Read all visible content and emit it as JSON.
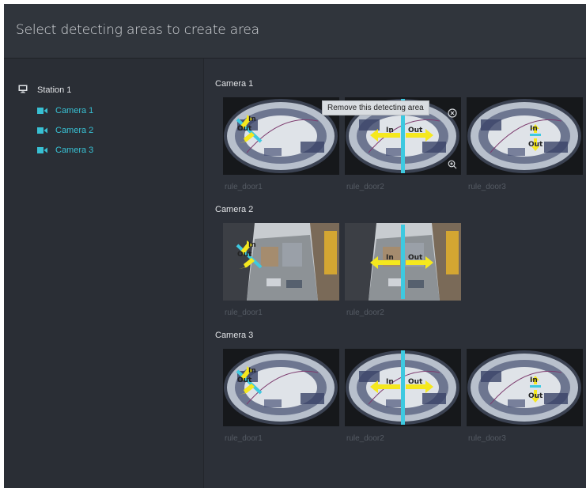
{
  "header": {
    "title": "Select detecting areas to create area"
  },
  "sidebar": {
    "station": {
      "label": "Station 1",
      "icon": "monitor-icon"
    },
    "cameras": [
      {
        "label": "Camera 1",
        "icon": "video-camera-icon"
      },
      {
        "label": "Camera 2",
        "icon": "video-camera-icon"
      },
      {
        "label": "Camera 3",
        "icon": "video-camera-icon"
      }
    ]
  },
  "overlay": {
    "in_label": "In",
    "out_label": "Out"
  },
  "sections": [
    {
      "title": "Camera 1",
      "rules": [
        {
          "label": "rule_door1",
          "view": "fisheye",
          "line": "diagonal"
        },
        {
          "label": "rule_door2",
          "view": "fisheye",
          "line": "vertical"
        },
        {
          "label": "rule_door3",
          "view": "fisheye",
          "line": "short"
        }
      ]
    },
    {
      "title": "Camera 2",
      "rules": [
        {
          "label": "rule_door1",
          "view": "street",
          "line": "diagonal"
        },
        {
          "label": "rule_door2",
          "view": "street",
          "line": "vertical"
        }
      ]
    },
    {
      "title": "Camera 3",
      "rules": [
        {
          "label": "rule_door1",
          "view": "fisheye",
          "line": "diagonal"
        },
        {
          "label": "rule_door2",
          "view": "fisheye",
          "line": "vertical"
        },
        {
          "label": "rule_door3",
          "view": "fisheye",
          "line": "short"
        }
      ]
    }
  ],
  "tooltip": {
    "text": "Remove this detecting area"
  },
  "actions": {
    "remove_icon": "close-circle-icon",
    "zoom_icon": "zoom-in-icon"
  },
  "colors": {
    "accent": "#38c0d3",
    "arrow": "#f5e81e",
    "line": "#3ec9e0"
  }
}
